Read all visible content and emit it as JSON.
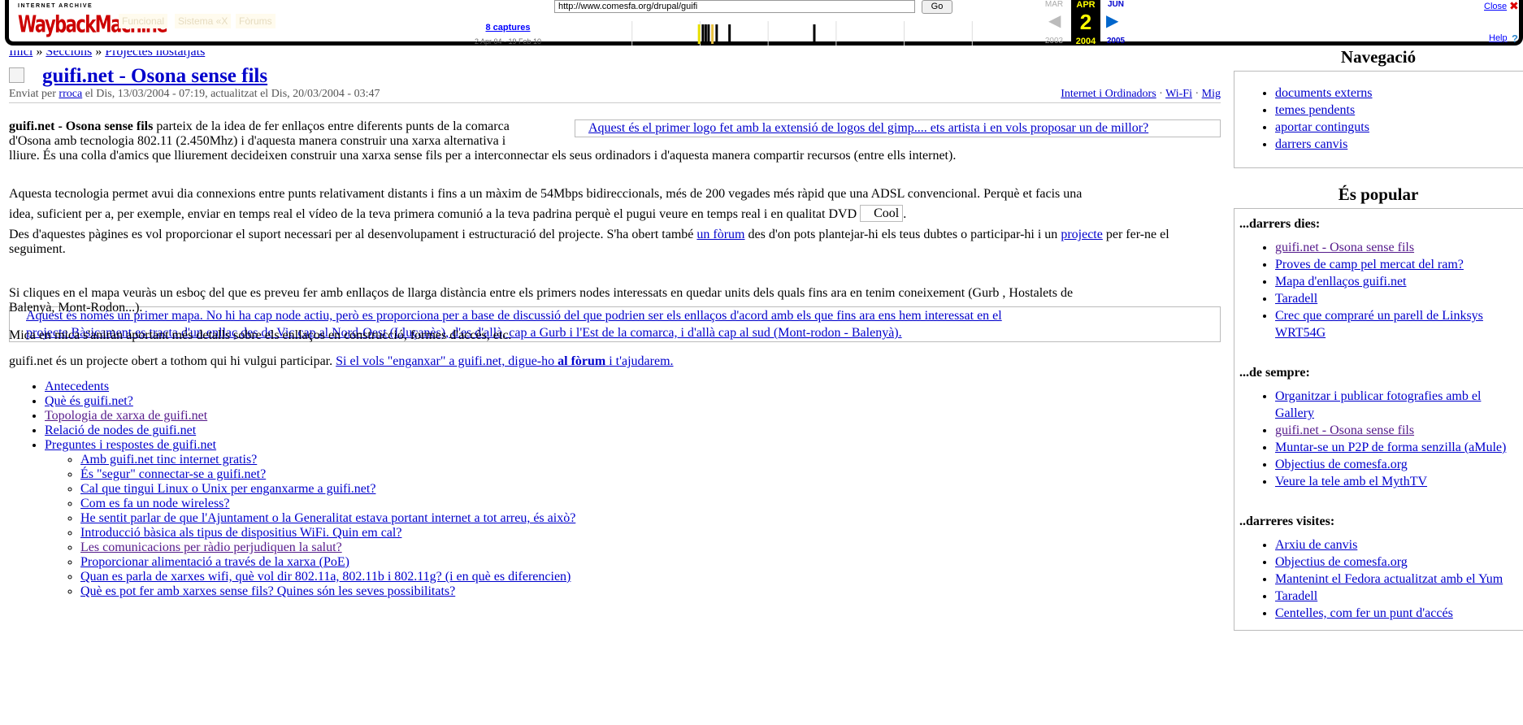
{
  "wayback": {
    "logo_top": "INTERNET ARCHIVE",
    "logo_main": "WaybackMachine",
    "faded_tabs": [
      "Funcional",
      "Sistema «X",
      "Fòrums"
    ],
    "url": "http://www.comesfa.org/drupal/guifi",
    "go_label": "Go",
    "captures_label": "8 captures",
    "range_label": "2 Apr 04 - 19 Feb 10",
    "prev_month": "MAR",
    "cur_month": "APR",
    "next_month": "JUN",
    "day": "2",
    "prev_year": "2003",
    "cur_year": "2004",
    "next_year": "2005",
    "close_label": "Close",
    "help_label": "Help",
    "accent_yellow": "#ffff00",
    "close_color": "#dd0000",
    "capture_ticks": [
      {
        "pos": 0.281,
        "color": "#e8e000",
        "h": 0.8
      },
      {
        "pos": 0.289,
        "color": "#000",
        "h": 0.8
      },
      {
        "pos": 0.295,
        "color": "#000",
        "h": 0.8
      },
      {
        "pos": 0.301,
        "color": "#000",
        "h": 0.8
      },
      {
        "pos": 0.309,
        "color": "#e8c040",
        "h": 0.8
      },
      {
        "pos": 0.318,
        "color": "#000",
        "h": 0.8
      },
      {
        "pos": 0.345,
        "color": "#000",
        "h": 0.8
      },
      {
        "pos": 0.523,
        "color": "#000",
        "h": 0.8
      }
    ]
  },
  "breadcrumb": [
    "Inici",
    "Seccions",
    "Projectes hostatjats"
  ],
  "node": {
    "title": "guifi.net - Osona sense fils",
    "submitted_prefix": "Enviat per",
    "author": "rroca",
    "submitted_suffix": "el Dis, 13/03/2004 - 07:19, actualitzat el Dis, 20/03/2004 - 03:47",
    "terms": [
      "Internet i Ordinadors",
      "Wi-Fi",
      "Mig"
    ],
    "p1_bold": "guifi.net - Osona sense fils",
    "p1_a": "parteix de la idea de fer enllaços entre diferents punts de la comarca",
    "p1_b": "d'Osona amb tecnologia 802.11 (2.450Mhz) i d'aquesta manera construir una xarxa alternativa i",
    "p1_c": "lliure. És una colla d'amics que lliurement decideixen construir una xarxa sense fils per a interconnectar els seus ordinadors i d'aquesta manera compartir recursos (entre ells internet).",
    "logo_alt": "Aquest és el primer logo fet amb la extensió de logos del gimp.... ets artista i en vols proposar un de millor?",
    "p2_a": "Aquesta tecnologia permet avui dia connexions entre punts relativament distants i fins a un màxim de 54Mbps bidireccionals, més de 200 vegades més ràpid que una ADSL convencional. Perquè et facis una",
    "p2_b": "idea, suficient per a, per exemple, enviar en temps real el vídeo de la teva primera comunió a la teva padrina perquè el pugui veure en temps real i en qualitat DVD",
    "cool_alt": "Cool",
    "p3_a": "Des d'aquestes pàgines es vol proporcionar el suport necessari per al desenvolupament i estructuració del projecte. S'ha obert també",
    "p3_link1": "un fòrum",
    "p3_b": "des d'on pots plantejar-hi els teus dubtes o participar-hi i un",
    "p3_link2": "projecte",
    "p3_c": "per fer-ne el seguiment.",
    "map_alt_1": "Aquest és només un primer mapa. No hi ha cap node actiu, però es proporciona per a base de discussió del que podrien ser els enllaços d'acord amb els que fins ara ens hem interessat en el",
    "map_alt_2": "projecte.Bàsicament es tracta d'un enllaç des de Vic cap al Nord-Oest (Lluçanès), d'es d'allà, cap a Gurb i l'Est de la comarca, i d'allà cap al sud (Mont-rodon - Balenyà).",
    "p4_a": "Si cliques en el mapa veuràs un esboç del que es preveu fer amb enllaços de llarga distància entre els primers nodes interessats en quedar units dels quals fins ara en tenim coneixement (Gurb , Hostalets de",
    "p4_b": "Balenyà, Mont-Rodon...).",
    "p5": "Mica en mica s'aniràn aportant més detalls sobre els enllaços en construcció, formes d'accès, etc.",
    "p6_a": "guifi.net és un projecte obert a tothom qui hi vulgui participar.",
    "p6_link_a": "Si el vols \"enganxar\" a guifi.net, digue-ho",
    "p6_link_b": "al fòrum",
    "p6_link_c": "i t'ajudarem.",
    "book_items": [
      {
        "label": "Antecedents",
        "visited": false
      },
      {
        "label": "Què és guifi.net?",
        "visited": false
      },
      {
        "label": "Topologia de xarxa de guifi.net",
        "visited": true
      },
      {
        "label": "Relació de nodes de guifi.net",
        "visited": false
      },
      {
        "label": "Preguntes i respostes de guifi.net",
        "visited": false
      }
    ],
    "faq_items": [
      {
        "label": "Amb guifi.net tinc internet gratis?",
        "visited": false
      },
      {
        "label": "És \"segur\" connectar-se a guifi.net?",
        "visited": false
      },
      {
        "label": "Cal que tingui Linux o Unix per enganxarme a guifi.net?",
        "visited": false
      },
      {
        "label": "Com es fa un node wireless?",
        "visited": false
      },
      {
        "label": "He sentit parlar de que l'Ajuntament o la Generalitat estava portant internet a tot arreu, és això?",
        "visited": false
      },
      {
        "label": "Introducció bàsica als tipus de dispositius WiFi. Quin em cal?",
        "visited": false
      },
      {
        "label": "Les comunicacions per ràdio perjudiquen la salut?",
        "visited": true
      },
      {
        "label": "Proporcionar alimentació a través de la xarxa (PoE)",
        "visited": false
      },
      {
        "label": "Quan es parla de xarxes wifi, què vol dir 802.11a, 802.11b i 802.11g? (i en què es diferencien)",
        "visited": false
      },
      {
        "label": "Què es pot fer amb xarxes sense fils? Quines són les seves possibilitats?",
        "visited": false
      }
    ]
  },
  "sidebar": {
    "nav_title": "Navegació",
    "nav_items": [
      "documents externs",
      "temes pendents",
      "aportar continguts",
      "darrers canvis"
    ],
    "popular_title": "És popular",
    "recent_title": "...darrers dies:",
    "recent_items": [
      {
        "label": "guifi.net - Osona sense fils",
        "visited": true
      },
      {
        "label": "Proves de camp pel mercat del ram?",
        "visited": false
      },
      {
        "label": "Mapa d'enllaços guifi.net",
        "visited": false
      },
      {
        "label": "Taradell",
        "visited": false
      },
      {
        "label": "Crec que compraré un parell de Linksys WRT54G",
        "visited": false
      }
    ],
    "alltime_title": "...de sempre:",
    "alltime_items": [
      {
        "label": "Organitzar i publicar fotografies amb el Gallery",
        "visited": false
      },
      {
        "label": "guifi.net - Osona sense fils",
        "visited": true
      },
      {
        "label": "Muntar-se un P2P de forma senzilla (aMule)",
        "visited": false
      },
      {
        "label": "Objectius de comesfa.org",
        "visited": false
      },
      {
        "label": "Veure la tele amb el MythTV",
        "visited": false
      }
    ],
    "lastviewed_title": "..darreres visites:",
    "lastviewed_items": [
      {
        "label": "Arxiu de canvis",
        "visited": false
      },
      {
        "label": "Objectius de comesfa.org",
        "visited": false
      },
      {
        "label": "Mantenint el Fedora actualitzat amb el Yum",
        "visited": false
      },
      {
        "label": "Taradell",
        "visited": false
      },
      {
        "label": "Centelles, com fer un punt d'accés",
        "visited": false
      }
    ]
  }
}
